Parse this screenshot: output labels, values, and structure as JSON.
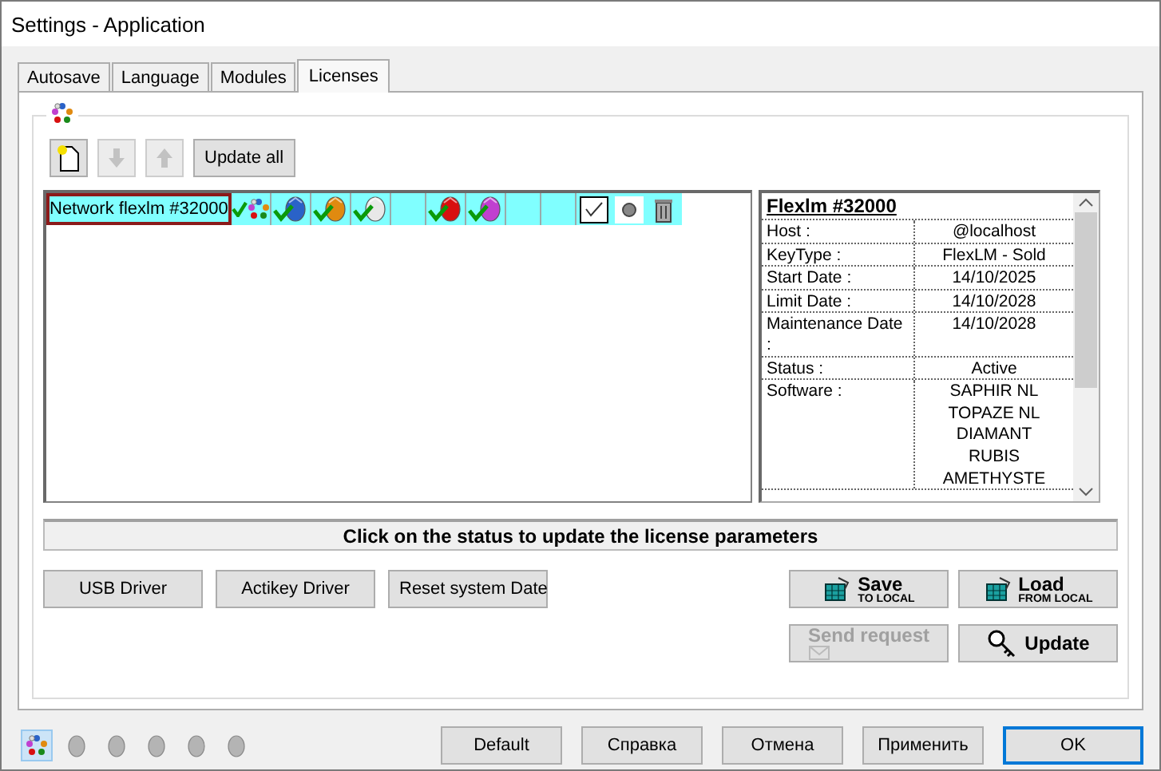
{
  "window": {
    "title": "Settings - Application"
  },
  "tabs": [
    {
      "label": "Autosave",
      "selected": false
    },
    {
      "label": "Language",
      "selected": false
    },
    {
      "label": "Modules",
      "selected": false
    },
    {
      "label": "Licenses",
      "selected": true
    }
  ],
  "toolbar": {
    "buttons": [
      {
        "kind": "new",
        "disabled": false
      },
      {
        "kind": "down",
        "disabled": true
      },
      {
        "kind": "up",
        "disabled": true
      }
    ],
    "update_all": "Update all"
  },
  "licenses": [
    {
      "name": "Network flexlm #32000",
      "selected": true,
      "modules": [
        {
          "kind": "multi",
          "checked": true
        },
        {
          "kind": "gem",
          "color": "#2a62c8",
          "checked": true
        },
        {
          "kind": "gem",
          "color": "#e08a10",
          "checked": true
        },
        {
          "kind": "gem",
          "color": "#e8e8e8",
          "checked": true
        },
        {
          "kind": "empty"
        },
        {
          "kind": "gem",
          "color": "#d81010",
          "checked": true
        },
        {
          "kind": "gem",
          "color": "#c040d0",
          "checked": true
        },
        {
          "kind": "empty"
        },
        {
          "kind": "empty"
        }
      ],
      "active": true
    }
  ],
  "details": {
    "title": "Flexlm #32000",
    "rows": [
      {
        "label": "Host :",
        "values": [
          "@localhost"
        ]
      },
      {
        "label": "KeyType :",
        "values": [
          "FlexLM - Sold"
        ]
      },
      {
        "label": "Start Date :",
        "values": [
          "14/10/2025"
        ]
      },
      {
        "label": "Limit Date :",
        "values": [
          "14/10/2028"
        ]
      },
      {
        "label": "Maintenance Date :",
        "values": [
          "14/10/2028"
        ]
      },
      {
        "label": "Status :",
        "values": [
          "Active"
        ]
      },
      {
        "label": "Software :",
        "values": [
          "SAPHIR NL",
          "TOPAZE NL",
          "DIAMANT",
          "RUBIS",
          "AMETHYSTE"
        ]
      }
    ]
  },
  "status_message": "Click on the status to update the license parameters",
  "driver_buttons": [
    "USB Driver",
    "Actikey Driver",
    "Reset system Date"
  ],
  "action_buttons": [
    {
      "kind": "save",
      "label": "Save",
      "sublabel": "TO LOCAL",
      "disabled": false
    },
    {
      "kind": "load",
      "label": "Load",
      "sublabel": "FROM LOCAL",
      "disabled": false
    },
    {
      "kind": "send",
      "label": "Send request",
      "disabled": true
    },
    {
      "kind": "update",
      "label": "Update",
      "disabled": false
    }
  ],
  "bottom_icons": [
    {
      "kind": "multi",
      "selected": true
    },
    {
      "kind": "gem",
      "selected": false
    },
    {
      "kind": "gem",
      "selected": false
    },
    {
      "kind": "gem",
      "selected": false
    },
    {
      "kind": "gem",
      "selected": false
    },
    {
      "kind": "gem",
      "selected": false
    }
  ],
  "footer_buttons": [
    {
      "label": "Default",
      "default": false
    },
    {
      "label": "Справка",
      "default": false
    },
    {
      "label": "Отмена",
      "default": false
    },
    {
      "label": "Применить",
      "default": false
    },
    {
      "label": "OK",
      "default": true
    }
  ]
}
